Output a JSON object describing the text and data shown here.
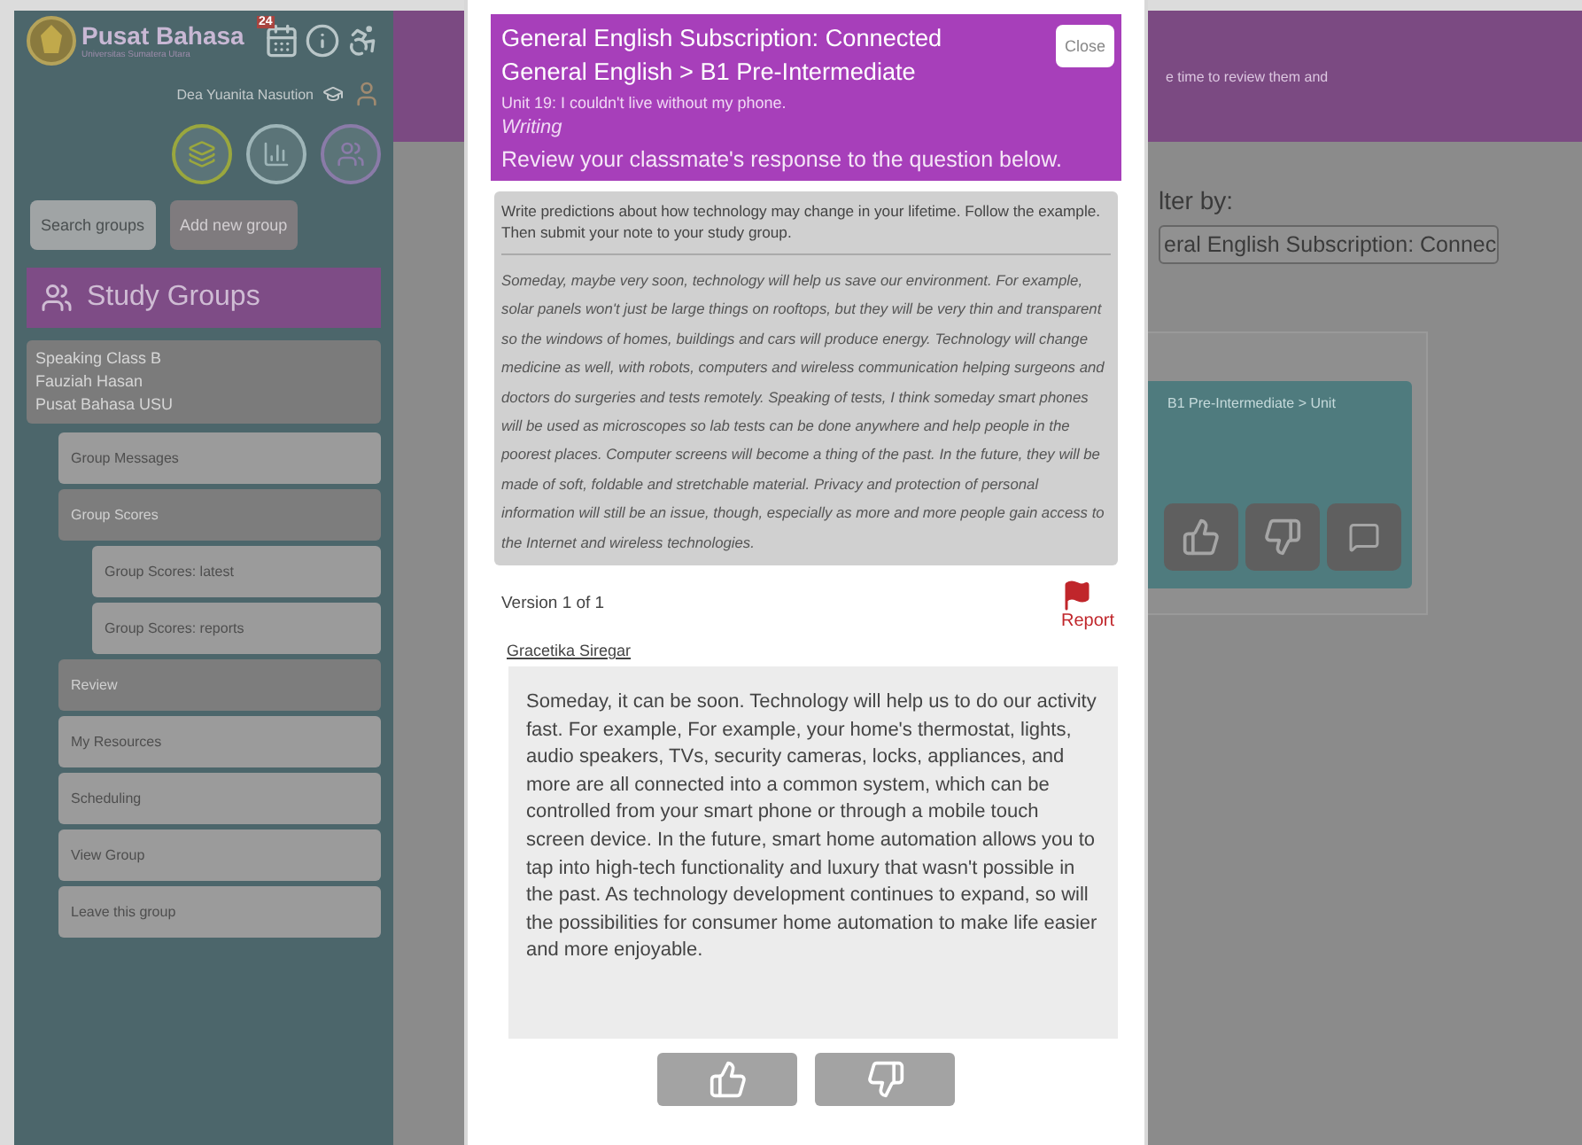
{
  "sidebar": {
    "brand": {
      "title": "Pusat Bahasa",
      "subtitle": "Universitas Sumatera Utara"
    },
    "calendar_badge": "24",
    "user_name": "Dea Yuanita Nasution",
    "buttons": [
      {
        "label": "Search groups",
        "disabled": false
      },
      {
        "label": "Add new group",
        "disabled": true
      }
    ],
    "section_title": "Study Groups",
    "group": {
      "lines": [
        "Speaking Class B",
        "Fauziah Hasan",
        "Pusat Bahasa USU"
      ]
    },
    "items": [
      {
        "label": "Group Messages",
        "selected": false
      },
      {
        "label": "Group Scores",
        "selected": true,
        "children": [
          {
            "label": "Group Scores: latest",
            "selected": false
          },
          {
            "label": "Group Scores: reports",
            "selected": false
          }
        ]
      },
      {
        "label": "Review",
        "selected": true
      },
      {
        "label": "My Resources",
        "selected": false
      },
      {
        "label": "Scheduling",
        "selected": false
      },
      {
        "label": "View Group",
        "selected": false
      },
      {
        "label": "Leave this group",
        "selected": false
      }
    ]
  },
  "main": {
    "header_text": "e time to review them and",
    "filter_label": "lter by:",
    "filter_value": "eral English Subscription: Connec",
    "card_text": "B1 Pre-Intermediate > Unit"
  },
  "modal": {
    "title": "General English Subscription: Connected General English > B1 Pre-Intermediate",
    "close": "Close",
    "unit": "Unit 19: I couldn't live without my phone.",
    "activity": "Writing",
    "instruction": "Review your classmate's response to the question below.",
    "prompt": "Write predictions about how technology may change in your lifetime. Follow the example. Then submit your note to your study group.",
    "example": "Someday, maybe very soon, technology will help us save our environment. For example, solar panels won't just be large things on rooftops, but they will be very thin and transparent so the windows of homes, buildings and cars will produce energy. Technology will change medicine as well, with robots, computers and wireless communication helping surgeons and doctors do surgeries and tests remotely. Speaking of tests, I think someday smart phones will be used as microscopes so lab tests can be done anywhere and help people in the poorest places. Computer screens will become a thing of the past. In the future, they will be made of soft, foldable and stretchable material. Privacy and protection of personal information will still be an issue, though, especially as more and more people gain access to the Internet and wireless technologies.",
    "version": "Version 1 of 1",
    "report": "Report",
    "author": "Gracetika Siregar",
    "response": "Someday, it can be soon. Technology will help us to do our activity fast. For example, For example, your home's thermostat, lights, audio speakers, TVs, security cameras, locks, appliances, and more are all connected into a common system, which can be controlled from your smart phone or through a mobile touch screen device. In the future, smart home automation allows you to tap into high-tech functionality and luxury that wasn't possible in the past. As technology development continues to expand, so will the possibilities for consumer home automation to make life easier and more enjoyable."
  }
}
